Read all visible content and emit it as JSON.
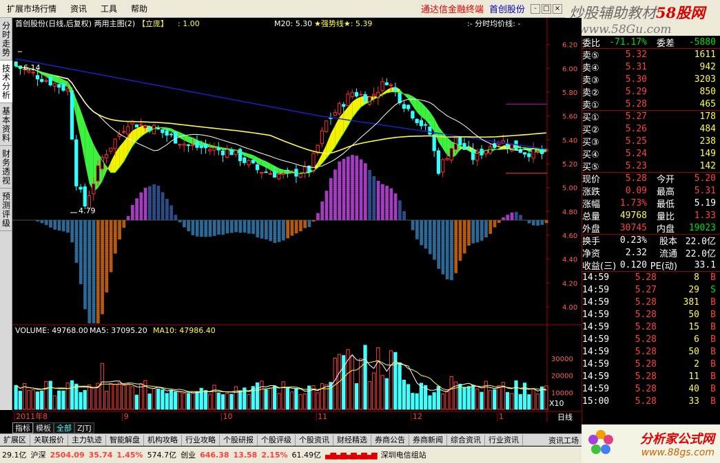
{
  "menu": {
    "items": [
      "扩展市场行情",
      "资讯",
      "工具",
      "帮助"
    ],
    "ad": "通达信金融终端",
    "brand": "首创股份",
    "winbtns": [
      "-",
      "□",
      "×"
    ]
  },
  "logo": {
    "line1": "炒股辅助教材",
    "line1b": "58股网",
    "line2": "www.58Gu.com"
  },
  "left_tabs": [
    "分时走势",
    "技术分析",
    "基本资料",
    "财务透视",
    "预测评级"
  ],
  "chart": {
    "header_left": "首创股份(日线,后复权) 两用主图(2)",
    "header_tag": "【立庞】",
    "header_val": ": 1.00",
    "m20": "M20: 5.30",
    "strong": "★强势线★: 5.39",
    "fenshi": ":- 分时均价线: -",
    "high_label": "6.14",
    "low_label": "4.79",
    "vol_header": "VOLUME: 49768.00",
    "ma5": "MA5: 37095.20",
    "ma10": "MA10: 47986.40",
    "x10": "X10",
    "period": "日线",
    "date_labels": [
      "2011年8",
      "9",
      "10",
      "11",
      "12",
      "1"
    ],
    "price_ticks": [
      "6.20",
      "6.00",
      "5.80",
      "5.60",
      "5.40",
      "5.20",
      "5.00",
      "4.80",
      "4.60",
      "4.40",
      "4.20",
      "4.00"
    ],
    "vol_ticks": [
      "30000",
      "20000",
      "10000"
    ]
  },
  "chart_data": {
    "type": "candlestick",
    "ylim": [
      4.0,
      6.25
    ],
    "highlighted": {
      "high": 6.14,
      "low": 4.79
    },
    "volume": {
      "last": 49768,
      "ma5": 37095.2,
      "ma10": 47986.4
    },
    "ma20_last": 5.3,
    "strong_last": 5.39
  },
  "quote": {
    "ratio": {
      "label": "委比",
      "value": "-71.17%",
      "diff_label": "委差",
      "diff": "-5880"
    },
    "asks": [
      {
        "label": "卖⑤",
        "price": "5.32",
        "vol": "1611"
      },
      {
        "label": "卖④",
        "price": "5.31",
        "vol": "942"
      },
      {
        "label": "卖③",
        "price": "5.30",
        "vol": "3203"
      },
      {
        "label": "卖②",
        "price": "5.29",
        "vol": "850"
      },
      {
        "label": "卖①",
        "price": "5.28",
        "vol": "465"
      }
    ],
    "bids": [
      {
        "label": "买①",
        "price": "5.27",
        "vol": "178"
      },
      {
        "label": "买②",
        "price": "5.26",
        "vol": "484"
      },
      {
        "label": "买③",
        "price": "5.25",
        "vol": "238"
      },
      {
        "label": "买④",
        "price": "5.24",
        "vol": "149"
      },
      {
        "label": "买⑤",
        "price": "5.23",
        "vol": "142"
      }
    ],
    "stats": [
      {
        "l1": "现价",
        "v1": "5.28",
        "c1": "red",
        "l2": "今开",
        "v2": "5.20",
        "c2": "red"
      },
      {
        "l1": "涨跌",
        "v1": "0.09",
        "c1": "red",
        "l2": "最高",
        "v2": "5.31",
        "c2": "red"
      },
      {
        "l1": "涨幅",
        "v1": "1.73%",
        "c1": "red",
        "l2": "最低",
        "v2": "5.19",
        "c2": "wht"
      },
      {
        "l1": "总量",
        "v1": "49768",
        "c1": "yel",
        "l2": "量比",
        "v2": "1.33",
        "c2": "red"
      },
      {
        "l1": "外盘",
        "v1": "30745",
        "c1": "red",
        "l2": "内盘",
        "v2": "19023",
        "c2": "green"
      }
    ],
    "stats2": [
      {
        "l1": "换手",
        "v1": "0.23%",
        "l2": "股本",
        "v2": "22.0亿"
      },
      {
        "l1": "净资",
        "v1": "2.32",
        "l2": "流通",
        "v2": "22.0亿"
      },
      {
        "l1": "收益(三)",
        "v1": "0.120",
        "l2": "PE(动)",
        "v2": "33.1"
      }
    ],
    "ticks": [
      {
        "t": "14:59",
        "p": "5.28",
        "v": "8",
        "s": "B"
      },
      {
        "t": "14:59",
        "p": "5.27",
        "v": "29",
        "s": "S"
      },
      {
        "t": "14:59",
        "p": "5.28",
        "v": "381",
        "s": "B"
      },
      {
        "t": "14:59",
        "p": "5.28",
        "v": "50",
        "s": "B"
      },
      {
        "t": "14:59",
        "p": "5.28",
        "v": "15",
        "s": "B"
      },
      {
        "t": "14:59",
        "p": "5.28",
        "v": "6",
        "s": "B"
      },
      {
        "t": "14:59",
        "p": "5.28",
        "v": "50",
        "s": "B"
      },
      {
        "t": "14:59",
        "p": "5.28",
        "v": "2",
        "s": "B"
      },
      {
        "t": "14:59",
        "p": "5.28",
        "v": "11",
        "s": "B"
      },
      {
        "t": "14:59",
        "p": "5.28",
        "v": "40",
        "s": "B"
      },
      {
        "t": "15:00",
        "p": "5.28",
        "v": "33",
        "s": "B"
      }
    ]
  },
  "subtabs": [
    "指标",
    "模板",
    "全部",
    "ZJTJ"
  ],
  "bottom_tabs": [
    "扩展区",
    "关联报价",
    "主力轨迹",
    "智能解盘",
    "机构攻略",
    "行业攻略",
    "个股研报",
    "个股评级",
    "个股资讯",
    "财经精选",
    "券商公告",
    "券商新闻",
    "综合资讯",
    "行业资讯"
  ],
  "bottom_right": "资讯工场",
  "status": {
    "s1": "29.1亿",
    "sh_label": "沪深",
    "sh_val": "2504.09",
    "sh_chg": "35.74",
    "sh_pct": "1.45%",
    "sh_amt": "574.7亿",
    "cy_label": "创业",
    "cy_val": "646.38",
    "cy_chg": "13.58",
    "cy_pct": "2.15%",
    "cy_amt": "61.49亿",
    "server": "深圳电信组站"
  },
  "ad": {
    "line1": "分析家公式网",
    "line2": "www.88gs.com"
  }
}
